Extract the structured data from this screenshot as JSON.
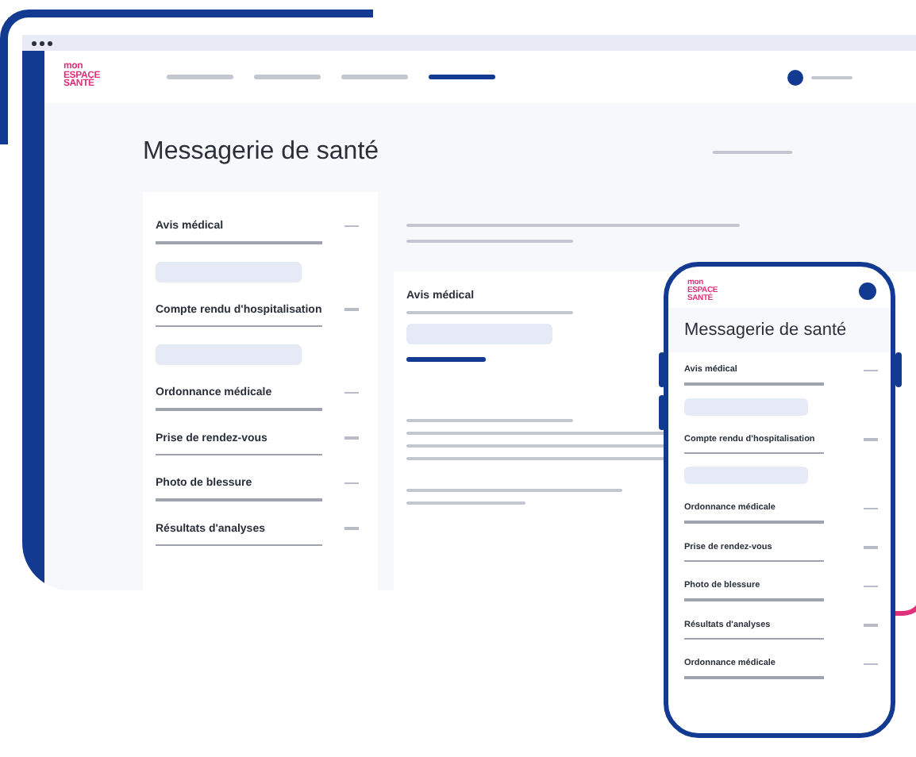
{
  "logo": {
    "lines": [
      "mon",
      "ESPACE",
      "SANTÉ"
    ]
  },
  "nav": [
    {
      "selected": false
    },
    {
      "selected": false
    },
    {
      "selected": false
    },
    {
      "selected": true
    }
  ],
  "page_title": "Messagerie de santé",
  "categories": [
    {
      "label": "Avis médical",
      "expanded": true
    },
    {
      "label": "Compte rendu d'hospitalisation",
      "expanded": true
    },
    {
      "label": "Ordonnance médicale",
      "expanded": false
    },
    {
      "label": "Prise de rendez-vous",
      "expanded": false
    },
    {
      "label": "Photo de blessure",
      "expanded": false
    },
    {
      "label": "Résultats d'analyses",
      "expanded": false
    }
  ],
  "detail": {
    "title": "Avis médical"
  },
  "phone": {
    "logo": {
      "lines": [
        "mon",
        "ESPACE",
        "SANTÉ"
      ]
    },
    "title": "Messagerie de santé",
    "categories": [
      {
        "label": "Avis médical",
        "expanded": true
      },
      {
        "label": "Compte rendu d'hospitalisation",
        "expanded": true
      },
      {
        "label": "Ordonnance médicale",
        "expanded": false
      },
      {
        "label": "Prise de rendez-vous",
        "expanded": false
      },
      {
        "label": "Photo de blessure",
        "expanded": false
      },
      {
        "label": "Résultats d'analyses",
        "expanded": false
      },
      {
        "label": "Ordonnance médicale",
        "expanded": false
      }
    ]
  }
}
